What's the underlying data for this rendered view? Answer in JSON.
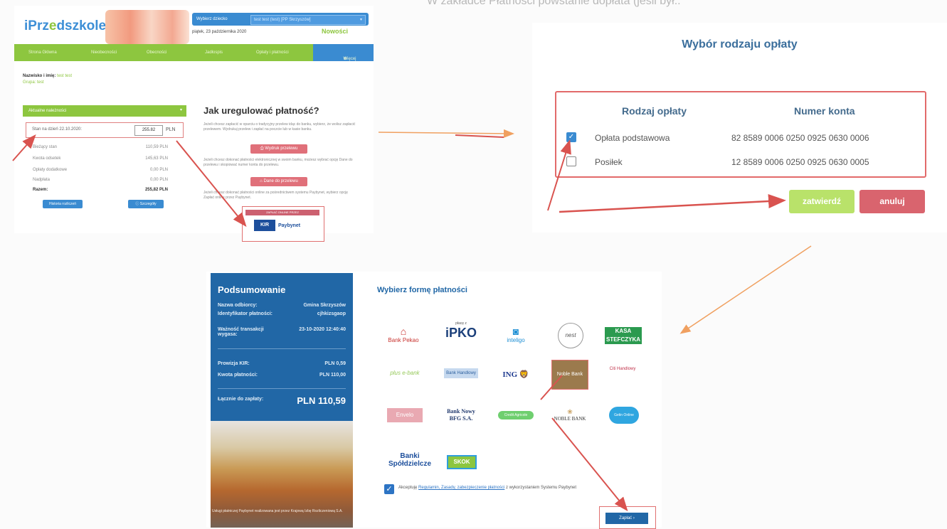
{
  "top_banner": "W zakładce Płatności powstanie dopłata (jeśli był..",
  "portal": {
    "logo_parts": [
      "iPrz",
      "e",
      "dszkole"
    ],
    "child_label": "Wybierz dziecko",
    "child_value": "test test (test) [PP Skrzyszów]",
    "date": "piątek, 23 października 2020",
    "news": "Nowości",
    "nav": [
      "Strona Główna",
      "Nieobecności",
      "Obecności",
      "Jadłospis",
      "Opłaty i płatności"
    ],
    "nav_more": "Więcej",
    "name_label": "Nazwisko i imię:",
    "name_value": "test test",
    "group_label": "Grupa:",
    "group_value": "test",
    "balance_header": "Aktualne należności",
    "balance_at": "Stan na dzień 22.10.2020:",
    "balance_value": "255.82",
    "currency": "PLN",
    "rows": [
      {
        "label": "Bieżący stan",
        "value": "110,59 PLN"
      },
      {
        "label": "Kwota odsetek",
        "value": "145,63 PLN"
      },
      {
        "label": "Opłaty dodatkowe",
        "value": "0,00 PLN"
      },
      {
        "label": "Nadpłata",
        "value": "0,00 PLN"
      },
      {
        "label": "Razem:",
        "value": "255,82 PLN"
      }
    ],
    "btn_history": "Historia rozliczeń",
    "btn_details": "Szczegóły",
    "how_title": "Jak uregulować płatność?",
    "how_text_1": "Jeżeli chcesz zapłacić w oparciu o tradycyjny przelew idąc do banku, wybierz, że wolisz zapłacić przelewem. Wydrukuj przelew i zapłać na poczcie lub w kasie banku.",
    "btn_print": "Wydruk przelewu",
    "how_text_2": "Jeżeli chcesz dokonać płatności elektronicznej w swoim banku, możesz wybrać opcję Dane do przelewu i skopiować numer konta do przelewu.",
    "btn_data": "Dane do przelewu",
    "how_text_3": "Jeżeli chcesz dokonać płatności online za pośrednictwem systemu Paybynet, wybierz opcję Zapłać online przez Paybynet.",
    "kir_bar": "ZAPŁAĆ ONLINE PRZEZ",
    "kir_logo": "KIR",
    "kir_pay": "Paybynet"
  },
  "modal": {
    "title": "Wybór rodzaju opłaty",
    "col_type": "Rodzaj opłaty",
    "col_account": "Numer konta",
    "rows": [
      {
        "type": "Opłata podstawowa",
        "account": "82 8589 0006 0250 0925 0630 0006",
        "checked": true
      },
      {
        "type": "Posiłek",
        "account": "12 8589 0006 0250 0925 0630 0005",
        "checked": false
      }
    ],
    "btn_confirm": "zatwierdź",
    "btn_cancel": "anuluj"
  },
  "payment": {
    "summary_title": "Podsumowanie",
    "recipient_label": "Nazwa odbiorcy:",
    "recipient_value": "Gmina Skrzyszów",
    "id_label": "Identyfikator płatności:",
    "id_value": "cjhkizsgaop",
    "valid_label": "Ważność transakcji wygasa:",
    "valid_value": "23-10-2020 12:40:40",
    "fee_label": "Prowizja KIR:",
    "fee_value": "PLN 0,59",
    "amount_label": "Kwota płatności:",
    "amount_value": "PLN 110,00",
    "total_label": "Łącznie do zapłaty:",
    "total_value": "PLN 110,59",
    "footnote": "Usługi płatniczej Paybynet realizowana jest przez Krajową Izbę Rozliczeniową S.A.",
    "choose_title": "Wybierz formę płatności",
    "banks": [
      "Bank Pekao",
      "iPKO",
      "inteligo",
      "nest",
      "KASA STEFCZYKA",
      "plus e-bank",
      "Bank Handlowy",
      "ING",
      "Noble Bank",
      "Citi Handlowy",
      "Envelo",
      "Bank Nowy BFG S.A.",
      "Credit Agricole",
      "NOBLE BANK",
      "Getin Online",
      "Banki Spółdzielcze",
      "SKOK"
    ],
    "ipko_small": "płacę z",
    "accept_pre": "Akceptuję",
    "accept_link": "Regulamin, Zasady, zabezpieczenie płatności",
    "accept_post": "z wykorzystaniem Systemu Paybynet",
    "pay_button": "Zapłać"
  }
}
